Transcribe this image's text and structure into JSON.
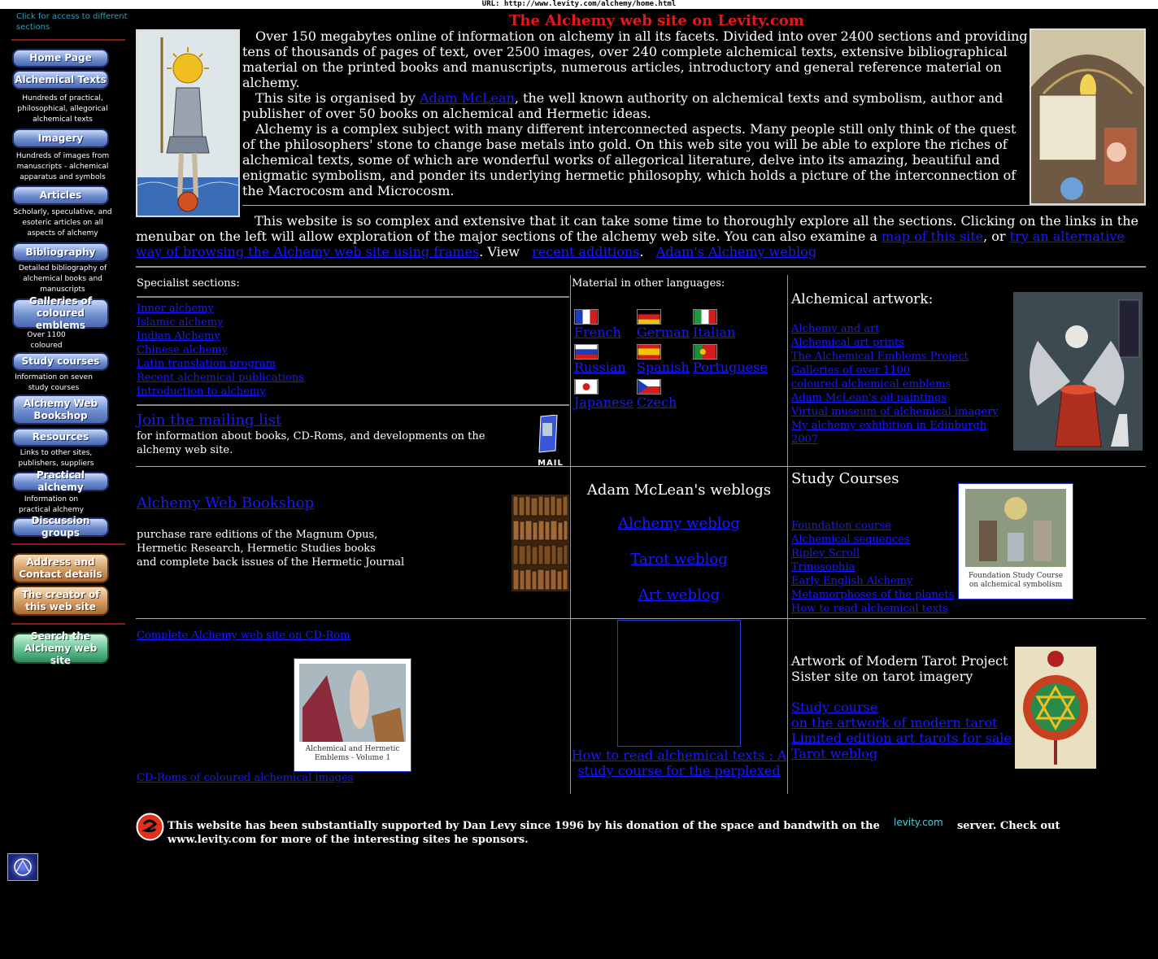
{
  "url_bar": "URL: http://www.levity.com/alchemy/home.html",
  "sidebar": {
    "top_note": "Click for access to different sections",
    "buttons": [
      {
        "label": "Home Page",
        "desc": ""
      },
      {
        "label": "Alchemical Texts",
        "desc": "Hundreds of practical, philosophical, allegorical alchemical texts"
      },
      {
        "label": "Imagery",
        "desc": "Hundreds of images from manuscripts - alchemical apparatus and symbols"
      },
      {
        "label": "Articles",
        "desc": "Scholarly, speculative, and esoteric articles on all aspects of alchemy"
      },
      {
        "label": "Bibliography",
        "desc": "Detailed bibliography of alchemical books and manuscripts"
      },
      {
        "label": "Galleries of coloured emblems",
        "desc": "Over 1100 coloured emblems"
      },
      {
        "label": "Study courses",
        "desc": "Information on seven study courses"
      },
      {
        "label": "Alchemy Web Bookshop",
        "desc": ""
      },
      {
        "label": "Resources",
        "desc": "Links to other sites, publishers, suppliers"
      },
      {
        "label": "Practical alchemy",
        "desc": "Information on practical alchemy"
      },
      {
        "label": "Discussion groups",
        "desc": ""
      },
      {
        "label": "Address and Contact details",
        "desc": ""
      },
      {
        "label": "The creator of this web site",
        "desc": ""
      },
      {
        "label": "Search the Alchemy web site",
        "desc": ""
      }
    ]
  },
  "main": {
    "title": "The Alchemy web site on Levity.com",
    "intro": {
      "p1": "Over 150 megabytes online of information on alchemy in all its facets. Divided into over 2400 sections and providing tens of thousands of pages of text, over 2500 images, over 240 complete alchemical texts, extensive bibliographical material on the printed books and manuscripts, numerous articles, introductory and general reference material on alchemy.",
      "p2_pre": "This site is organised by ",
      "p2_link": "Adam McLean",
      "p2_post": ", the well known authority on alchemical texts and symbolism, author and publisher of over 50 books on alchemical and Hermetic ideas.",
      "p3": "Alchemy is a complex subject with many different interconnected aspects. Many people still only think of the quest of the philosophers' stone to change base metals into gold. On this web site you will be able to explore the riches of alchemical texts, some of which are wonderful works of allegorical literature, delve into its amazing, beautiful and enigmatic symbolism, and ponder its underlying hermetic philosophy, which holds a picture of the interconnection of the Macrocosm and Microcosm.",
      "p4_pre": "This website is so complex and extensive that it can take some time to thoroughly explore all the sections. Clicking on the links in the menubar on the left will allow exploration of the major sections of the alchemy web site. You can also examine a ",
      "p4_link1": "map of this site",
      "p4_mid": ", or ",
      "p4_link2": "try an alternative way of browsing the Alchemy web site using frames",
      "p4_view": ". View ",
      "p4_link3": "recent additions",
      "p4_dot": ".",
      "p4_link4": "Adam's Alchemy weblog"
    },
    "specialist": {
      "heading": "Specialist sections:",
      "links": [
        "Inner alchemy",
        "Islamic alchemy",
        "Indian Alchemy",
        "Chinese alchemy",
        "Latin translation program",
        "Recent alchemical publications",
        "Introduction to alchemy"
      ],
      "mailing_link": "Join the mailing list",
      "mailing_desc": "for information about books, CD-Roms, and developments on the alchemy web site.",
      "mail_icon_label": "MAIL"
    },
    "languages": {
      "heading": "Material in other languages:",
      "items": [
        "French",
        "German",
        "Italian",
        "Russian",
        "Spanish",
        "Portuguese",
        "Japanese",
        "Czech"
      ]
    },
    "artwork": {
      "heading": "Alchemical artwork:",
      "links": [
        "Alchemy and art",
        "Alchemical art prints",
        "The Alchemical Emblems Project",
        "Galleries of over 1100",
        "coloured alchemical emblems",
        "Adam McLean's oil paintings",
        "Virtual museum of alchemical imagery",
        "My alchemy exhibition in Edinburgh",
        "2007"
      ]
    },
    "bookshop": {
      "link": "Alchemy Web Bookshop",
      "desc1": "purchase rare editions of the Magnum Opus,",
      "desc2": "Hermetic Research, Hermetic Studies books",
      "desc3": "and complete back issues of the Hermetic Journal"
    },
    "weblogs": {
      "heading": "Adam McLean's weblogs",
      "links": [
        "Alchemy weblog",
        "Tarot weblog",
        "Art weblog"
      ]
    },
    "study": {
      "heading": "Study Courses",
      "links": [
        "Foundation course",
        "Alchemical sequences",
        "Ripley Scroll",
        "Trinosophia",
        "Early English Alchemy",
        "Metamorphoses of the planets",
        "How to read alchemical texts"
      ],
      "cover_caption": "Foundation Study Course on alchemical symbolism"
    },
    "cdrom": {
      "link1": "Complete Alchemy web site on CD-Rom",
      "cover_caption": "Alchemical and Hermetic Emblems - Volume 1",
      "link2": "CD-Roms of coloured alchemical images"
    },
    "howto": {
      "link": "How to read alchemical texts : A study course for the perplexed"
    },
    "tarot": {
      "line1": "Artwork of Modern Tarot Project",
      "line2": "Sister site on tarot imagery",
      "links": [
        "Study course",
        "on the artwork of modern tarot",
        "Limited edition art tarots for sale",
        "Tarot weblog"
      ]
    },
    "footer": {
      "text_pre": "This website has been substantially supported by Dan Levy since 1996 by his donation of the space and bandwith on the",
      "logo": "levity.com",
      "text_post": "server. Check out",
      "line2": "www.levity.com for more of the interesting sites he sponsors."
    }
  }
}
